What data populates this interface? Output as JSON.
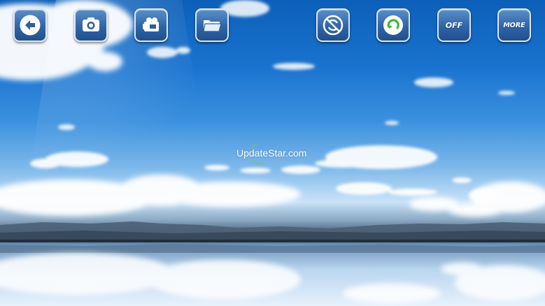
{
  "toolbar": {
    "buttons": [
      {
        "id": "back",
        "icon": "back-arrow-icon"
      },
      {
        "id": "camera",
        "icon": "camera-icon"
      },
      {
        "id": "video",
        "icon": "video-camera-icon"
      },
      {
        "id": "folder",
        "icon": "folder-icon"
      },
      {
        "id": "rotate",
        "icon": "rotate-crossed-icon"
      },
      {
        "id": "refresh",
        "icon": "refresh-icon"
      },
      {
        "id": "off",
        "label": "OFF"
      },
      {
        "id": "more",
        "label": "MORE"
      }
    ]
  },
  "watermark": "UpdateStar.com",
  "colors": {
    "button_top": "#5a8fc6",
    "button_bottom": "#214f8d",
    "refresh_green": "#3dbb3a",
    "spinner": "#78c27a"
  }
}
